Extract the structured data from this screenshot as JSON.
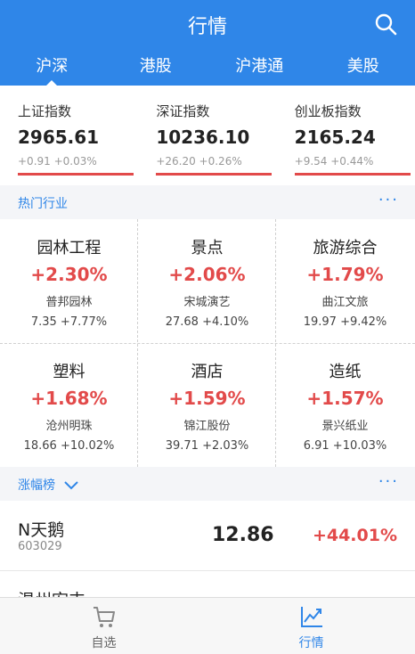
{
  "header": {
    "title": "行情"
  },
  "tabs": [
    {
      "label": "沪深",
      "active": true
    },
    {
      "label": "港股",
      "active": false
    },
    {
      "label": "沪港通",
      "active": false
    },
    {
      "label": "美股",
      "active": false
    }
  ],
  "indices": [
    {
      "name": "上证指数",
      "value": "2965.61",
      "change": "+0.91 +0.03%"
    },
    {
      "name": "深证指数",
      "value": "10236.10",
      "change": "+26.20 +0.26%"
    },
    {
      "name": "创业板指数",
      "value": "2165.24",
      "change": "+9.54 +0.44%"
    }
  ],
  "hot_sectors": {
    "title": "热门行业",
    "more": "···",
    "items": [
      {
        "industry": "园林工程",
        "pct": "+2.30%",
        "stock": "普邦园林",
        "detail": "7.35 +7.77%"
      },
      {
        "industry": "景点",
        "pct": "+2.06%",
        "stock": "宋城演艺",
        "detail": "27.68 +4.10%"
      },
      {
        "industry": "旅游综合",
        "pct": "+1.79%",
        "stock": "曲江文旅",
        "detail": "19.97 +9.42%"
      },
      {
        "industry": "塑料",
        "pct": "+1.68%",
        "stock": "沧州明珠",
        "detail": "18.66 +10.02%"
      },
      {
        "industry": "酒店",
        "pct": "+1.59%",
        "stock": "锦江股份",
        "detail": "39.71 +2.03%"
      },
      {
        "industry": "造纸",
        "pct": "+1.57%",
        "stock": "景兴纸业",
        "detail": "6.91 +10.03%"
      }
    ]
  },
  "gainers": {
    "title": "涨幅榜",
    "more": "···",
    "rows": [
      {
        "name": "N天鹅",
        "code": "603029",
        "price": "12.86",
        "change": "+44.01%"
      },
      {
        "name": "温州宏丰",
        "code": "",
        "price": "",
        "change": ""
      }
    ]
  },
  "bottom_nav": [
    {
      "label": "自选",
      "icon": "cart-icon",
      "active": false
    },
    {
      "label": "行情",
      "icon": "trend-chart-icon",
      "active": true
    }
  ],
  "colors": {
    "primary": "#2f86e8",
    "up": "#e24a4a"
  }
}
